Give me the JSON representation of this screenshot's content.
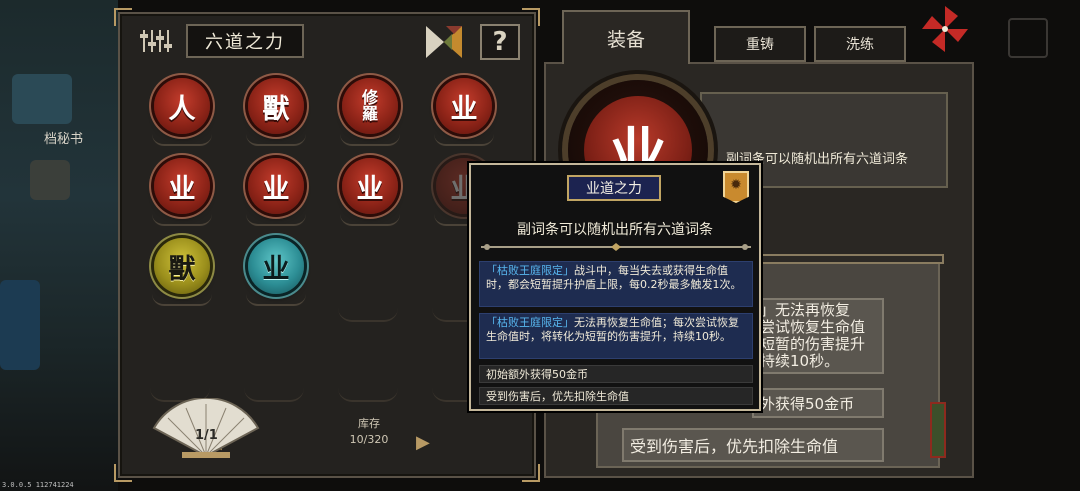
{
  "scenery": {
    "label": "档秘书"
  },
  "version": "3.0.0.5 112741224",
  "left_panel": {
    "title": "六道之力",
    "help_label": "?",
    "page": "1/1",
    "stock_label": "库存",
    "stock_value": "10/320",
    "prev_arrow": "◀",
    "next_arrow": "▶",
    "slots": [
      {
        "glyph": "人",
        "color": "red"
      },
      {
        "glyph": "獸",
        "color": "red"
      },
      {
        "glyph": "修羅",
        "color": "red"
      },
      {
        "glyph": "业",
        "color": "red"
      },
      {
        "glyph": "业",
        "color": "red"
      },
      {
        "glyph": "业",
        "color": "red"
      },
      {
        "glyph": "业",
        "color": "red"
      },
      {
        "glyph": "业",
        "color": "red-dim"
      },
      {
        "glyph": "獸",
        "color": "yellow"
      },
      {
        "glyph": "业",
        "color": "teal"
      }
    ]
  },
  "right_panel": {
    "tabs": [
      "装备",
      "重铸",
      "洗练"
    ],
    "big_coin_glyph": "业",
    "description": "副词条可以随机出所有六道词条",
    "scroll_items": [
      "」无法再恢复",
      "尝试恢复生命值",
      "短暂的伤害提升",
      "持续10秒。",
      "外获得50金币",
      "受到伤害后，优先扣除生命值"
    ]
  },
  "tooltip": {
    "title": "业道之力",
    "badge": "✹",
    "subtitle": "副词条可以随机出所有六道词条",
    "rows": [
      {
        "highlight": "「枯败王庭限定」",
        "text": "战斗中，每当失去或获得生命值时，都会短暂提升护盾上限，每0.2秒最多触发1次。"
      },
      {
        "highlight": "「枯败王庭限定」",
        "text": "无法再恢复生命值；每次尝试恢复生命值时，将转化为短暂的伤害提升，持续10秒。"
      },
      {
        "highlight": "",
        "text": "初始额外获得50金币"
      },
      {
        "highlight": "",
        "text": "受到伤害后，优先扣除生命值"
      }
    ]
  },
  "colors": {
    "accent_gold": "#c1a563",
    "coin_red": "#8e2418",
    "coin_yellow": "#9b8f1c",
    "coin_teal": "#2c8d94",
    "highlight_blue": "#58b7ef"
  }
}
